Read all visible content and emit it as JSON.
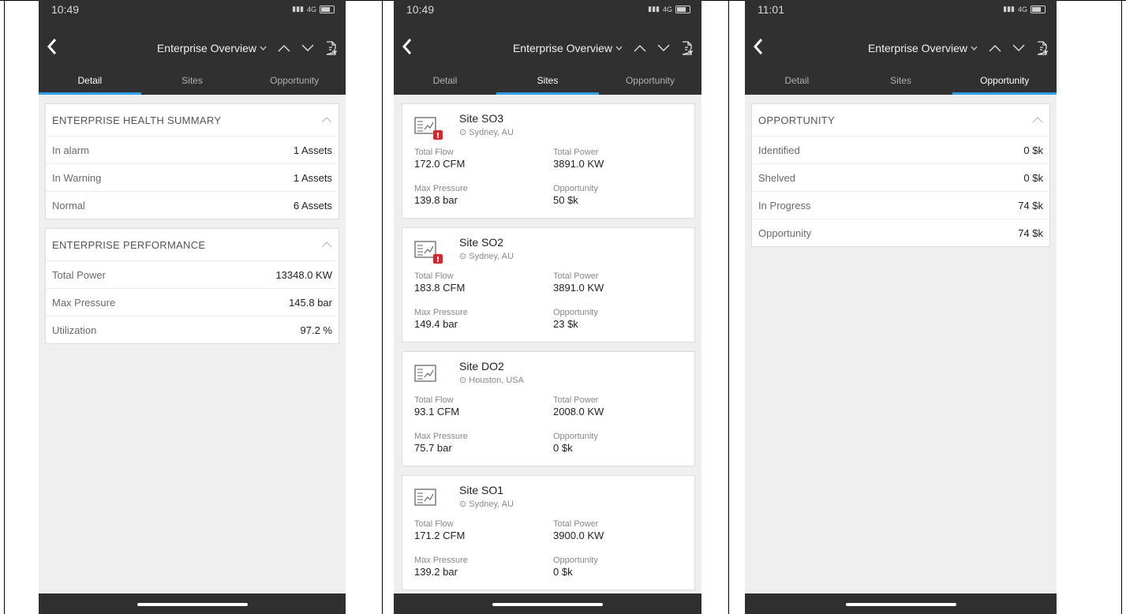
{
  "screens": [
    {
      "time": "10:49",
      "network": "4G",
      "title": "Enterprise Overview",
      "tabs": [
        "Detail",
        "Sites",
        "Opportunity"
      ],
      "active_tab": 0,
      "cards": [
        {
          "title": "ENTERPRISE HEALTH SUMMARY",
          "rows": [
            {
              "label": "In alarm",
              "value": "1 Assets"
            },
            {
              "label": "In Warning",
              "value": "1 Assets"
            },
            {
              "label": "Normal",
              "value": "6 Assets"
            }
          ]
        },
        {
          "title": "ENTERPRISE PERFORMANCE",
          "rows": [
            {
              "label": "Total Power",
              "value": "13348.0 KW"
            },
            {
              "label": "Max Pressure",
              "value": "145.8 bar"
            },
            {
              "label": "Utilization",
              "value": "97.2 %"
            }
          ]
        }
      ]
    },
    {
      "time": "10:49",
      "network": "4G",
      "title": "Enterprise Overview",
      "tabs": [
        "Detail",
        "Sites",
        "Opportunity"
      ],
      "active_tab": 1,
      "metric_labels": {
        "total_flow": "Total Flow",
        "total_power": "Total Power",
        "max_pressure": "Max Pressure",
        "opportunity": "Opportunity"
      },
      "sites": [
        {
          "name": "Site SO3",
          "location": "Sydney, AU",
          "alarm": true,
          "total_flow": "172.0 CFM",
          "total_power": "3891.0 KW",
          "max_pressure": "139.8 bar",
          "opportunity": "50 $k"
        },
        {
          "name": "Site SO2",
          "location": "Sydney, AU",
          "alarm": true,
          "total_flow": "183.8 CFM",
          "total_power": "3891.0 KW",
          "max_pressure": "149.4 bar",
          "opportunity": "23 $k"
        },
        {
          "name": "Site DO2",
          "location": "Houston, USA",
          "alarm": false,
          "total_flow": "93.1 CFM",
          "total_power": "2008.0 KW",
          "max_pressure": "75.7 bar",
          "opportunity": "0 $k"
        },
        {
          "name": "Site SO1",
          "location": "Sydney, AU",
          "alarm": false,
          "total_flow": "171.2 CFM",
          "total_power": "3900.0 KW",
          "max_pressure": "139.2 bar",
          "opportunity": "0 $k"
        }
      ]
    },
    {
      "time": "11:01",
      "network": "4G",
      "title": "Enterprise Overview",
      "tabs": [
        "Detail",
        "Sites",
        "Opportunity"
      ],
      "active_tab": 2,
      "cards": [
        {
          "title": "OPPORTUNITY",
          "rows": [
            {
              "label": "Identified",
              "value": "0 $k"
            },
            {
              "label": "Shelved",
              "value": "0 $k"
            },
            {
              "label": "In Progress",
              "value": "74 $k"
            },
            {
              "label": "Opportunity",
              "value": "74 $k"
            }
          ]
        }
      ]
    }
  ],
  "colors": {
    "header_bg": "#303030",
    "tab_indicator": "#2f9ee6",
    "page_bg": "#efefef",
    "alarm_badge": "#d9262c"
  }
}
